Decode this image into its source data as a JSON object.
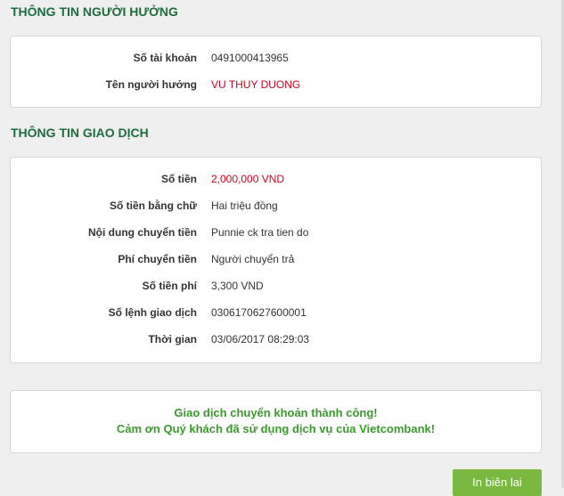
{
  "beneficiary": {
    "title": "THÔNG TIN NGƯỜI HƯỞNG",
    "rows": [
      {
        "label": "Số tài khoản",
        "value": "0491000413965"
      },
      {
        "label": "Tên người hưởng",
        "value": "VU THUY DUONG"
      }
    ]
  },
  "transaction": {
    "title": "THÔNG TIN GIAO DỊCH",
    "rows": [
      {
        "label": "Số tiền",
        "value": "2,000,000 VND"
      },
      {
        "label": "Số tiền bằng chữ",
        "value": "Hai triệu đồng"
      },
      {
        "label": "Nội dung chuyển tiền",
        "value": "Punnie ck tra tien do"
      },
      {
        "label": "Phí chuyển tiền",
        "value": "Người chuyển trả"
      },
      {
        "label": "Số tiền phí",
        "value": "3,300 VND"
      },
      {
        "label": "Số lệnh giao dịch",
        "value": "0306170627600001"
      },
      {
        "label": "Thời gian",
        "value": "03/06/2017 08:29:03"
      }
    ]
  },
  "success": {
    "line1": "Giao dịch chuyển khoản thành công!",
    "line2": "Cảm ơn Quý khách đã sử dụng dịch vụ của Vietcombank!"
  },
  "actions": {
    "print_label": "In biên lai"
  },
  "colors": {
    "section_title": "#1c6e3d",
    "highlight_value": "#d0021b",
    "success_text": "#3a9a2c",
    "print_button": "#7ab840"
  }
}
